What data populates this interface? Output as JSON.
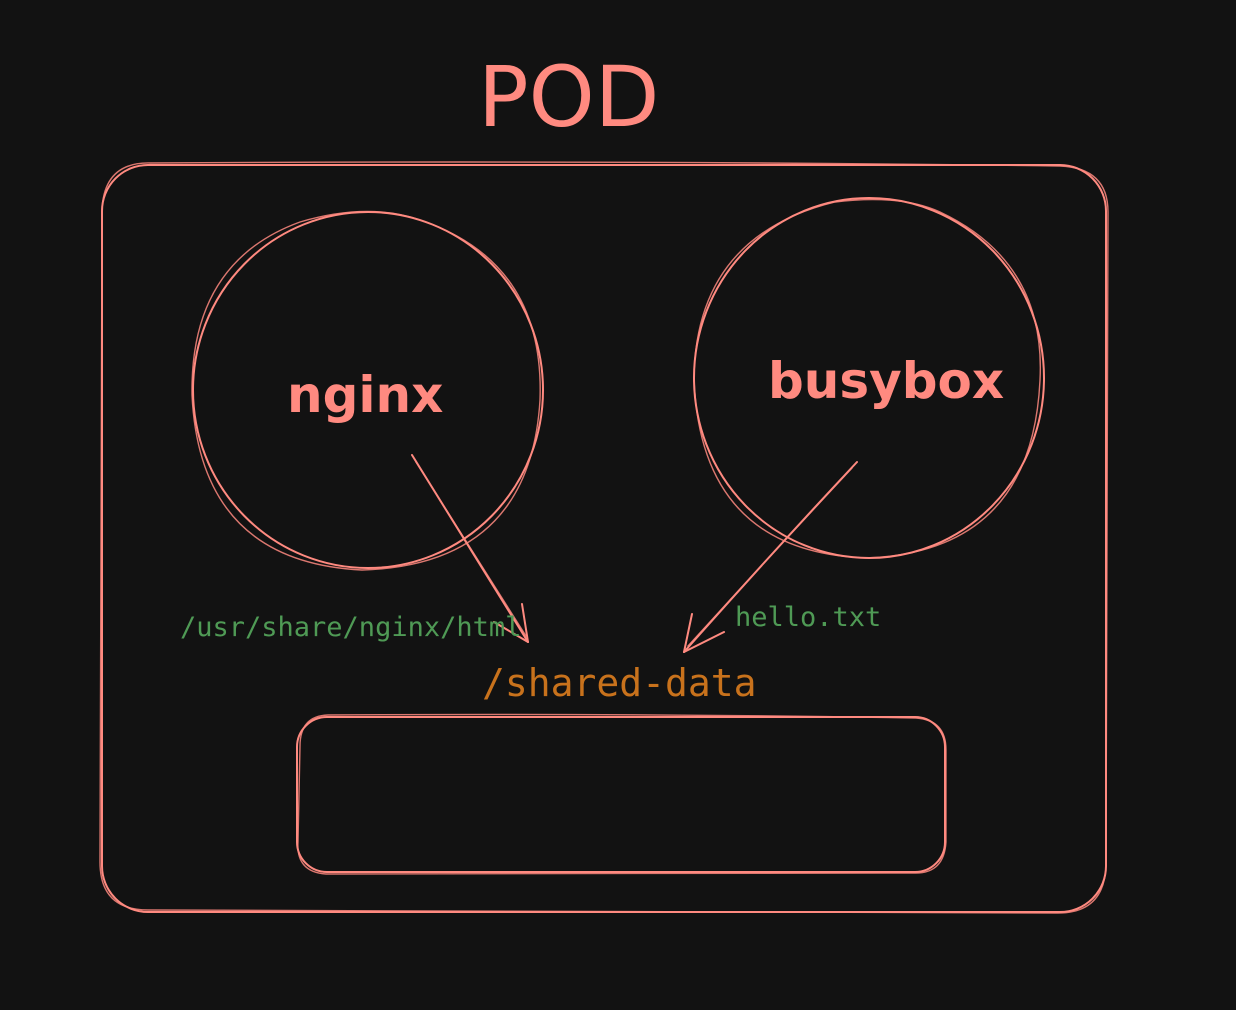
{
  "title": "POD",
  "containers": [
    {
      "name": "nginx",
      "mount_path": "/usr/share/nginx/html"
    },
    {
      "name": "busybox",
      "mount_path": "hello.txt"
    }
  ],
  "volume": {
    "name": "/shared-data"
  },
  "colors": {
    "background": "#121212",
    "outline": "#ff8a80",
    "path_label": "#4f9a55",
    "volume_label": "#c8721c"
  }
}
